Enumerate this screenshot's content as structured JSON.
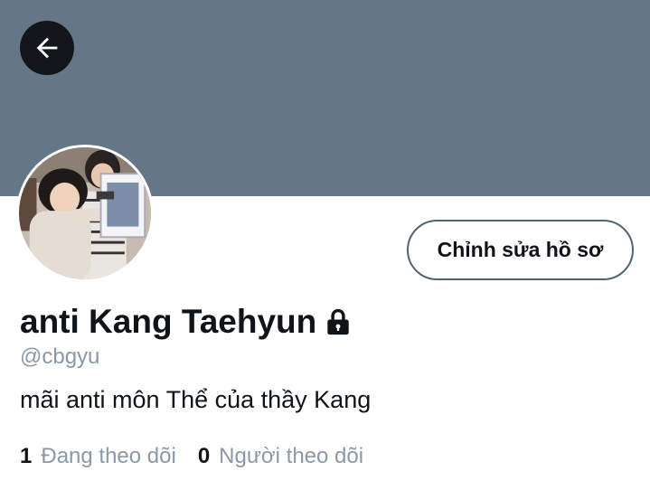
{
  "profile": {
    "display_name": "anti Kang Taehyun",
    "handle": "@cbgyu",
    "bio": "mãi anti môn Thể của thầy Kang",
    "protected": true
  },
  "actions": {
    "edit_profile_label": "Chỉnh sửa hồ sơ"
  },
  "stats": {
    "following_count": "1",
    "following_label": "Đang theo dõi",
    "followers_count": "0",
    "followers_label": "Người theo dõi"
  },
  "icons": {
    "back": "arrow-left-icon",
    "lock": "lock-icon"
  },
  "colors": {
    "banner": "#657786",
    "back_button_bg": "#13171b",
    "text_primary": "#0f1419",
    "text_secondary": "#8b98a5",
    "button_border": "#536471"
  }
}
